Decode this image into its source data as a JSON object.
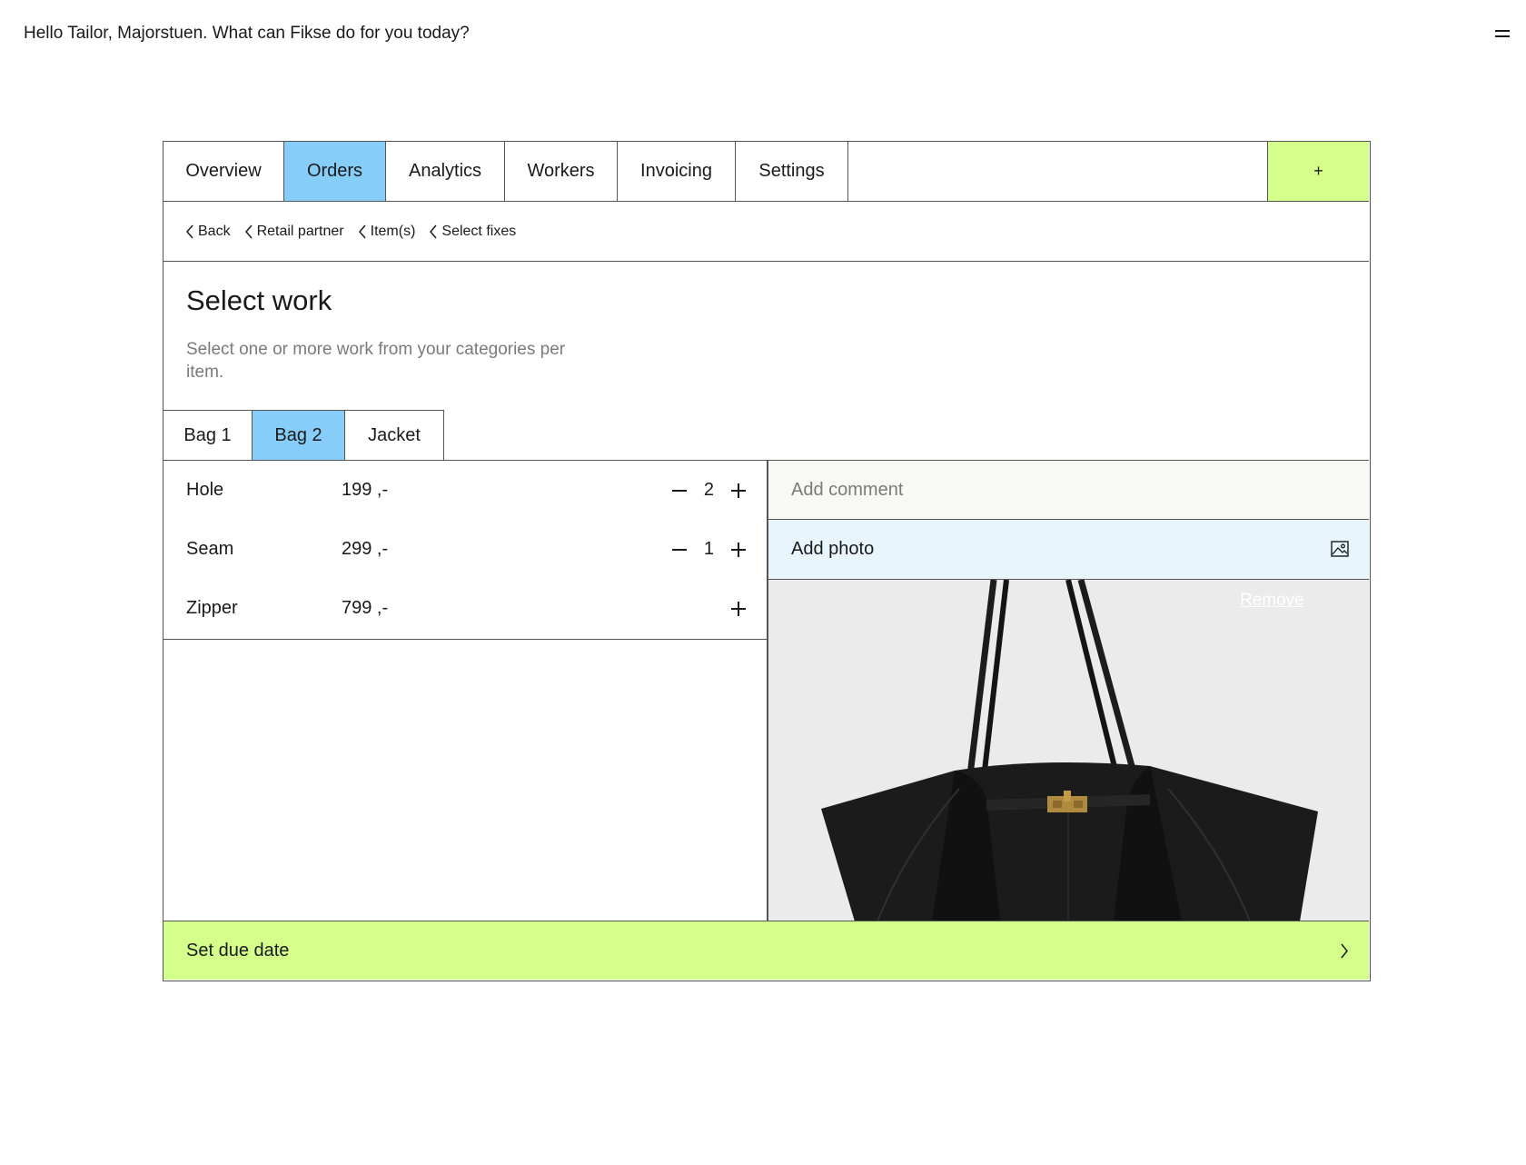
{
  "header": {
    "greeting": "Hello Tailor, Majorstuen. What can Fikse do for you today?"
  },
  "nav": {
    "tabs": [
      {
        "label": "Overview",
        "active": false
      },
      {
        "label": "Orders",
        "active": true
      },
      {
        "label": "Analytics",
        "active": false
      },
      {
        "label": "Workers",
        "active": false
      },
      {
        "label": "Invoicing",
        "active": false
      },
      {
        "label": "Settings",
        "active": false
      }
    ],
    "add_label": "+"
  },
  "breadcrumbs": [
    "Back",
    "Retail partner",
    "Item(s)",
    "Select fixes"
  ],
  "page": {
    "title": "Select work",
    "subtitle": "Select one or more work from your categories per item."
  },
  "items": {
    "tabs": [
      {
        "label": "Bag 1",
        "active": false
      },
      {
        "label": "Bag 2",
        "active": true
      },
      {
        "label": "Jacket",
        "active": false
      }
    ]
  },
  "work": [
    {
      "name": "Hole",
      "price": "199 ,-",
      "quantity": "2"
    },
    {
      "name": "Seam",
      "price": "299 ,-",
      "quantity": "1"
    },
    {
      "name": "Zipper",
      "price": "799 ,-",
      "quantity": ""
    }
  ],
  "comment": {
    "placeholder": "Add comment"
  },
  "photo": {
    "add_label": "Add photo",
    "remove_label": "Remove"
  },
  "footer": {
    "due_date_label": "Set due date"
  },
  "colors": {
    "active_tab": "#87cdf9",
    "accent_green": "#d3ff8a",
    "photo_bar": "#e8f5fc",
    "comment_bg": "#f8f8f4"
  }
}
